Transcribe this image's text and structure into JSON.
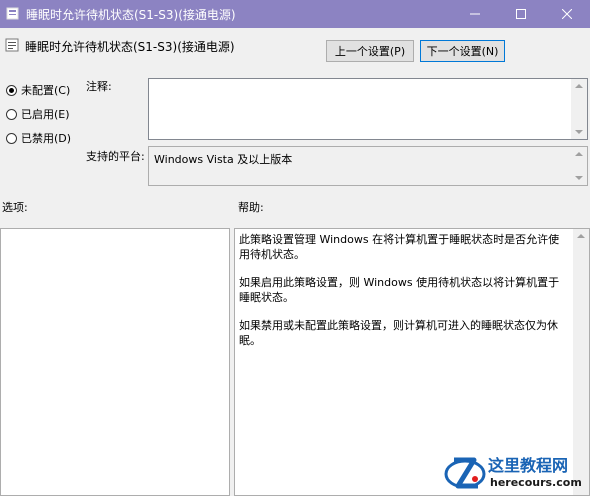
{
  "window": {
    "title": "睡眠时允许待机状态(S1-S3)(接通电源)",
    "controls": {
      "minimize": "minimize-icon",
      "maximize": "maximize-icon",
      "close": "close-icon"
    }
  },
  "header": {
    "policy_name": "睡眠时允许待机状态(S1-S3)(接通电源)",
    "prev_button": "上一个设置(P)",
    "next_button": "下一个设置(N)"
  },
  "state_options": [
    {
      "label": "未配置(C)",
      "checked": true
    },
    {
      "label": "已启用(E)",
      "checked": false
    },
    {
      "label": "已禁用(D)",
      "checked": false
    }
  ],
  "comment": {
    "label": "注释:",
    "value": ""
  },
  "supported": {
    "label": "支持的平台:",
    "value": "Windows Vista 及以上版本"
  },
  "options": {
    "label": "选项:"
  },
  "help": {
    "label": "帮助:",
    "paragraphs": [
      "此策略设置管理 Windows 在将计算机置于睡眠状态时是否允许使用待机状态。",
      "如果启用此策略设置，则 Windows 使用待机状态以将计算机置于睡眠状态。",
      "如果禁用或未配置此策略设置，则计算机可进入的睡眠状态仅为休眠。"
    ]
  },
  "watermark": {
    "title": "这里教程网",
    "url": "herecours.com"
  },
  "colors": {
    "titlebar": "#8c83c2",
    "window_bg": "#f0f0f0",
    "focus_border": "#0078d7"
  }
}
